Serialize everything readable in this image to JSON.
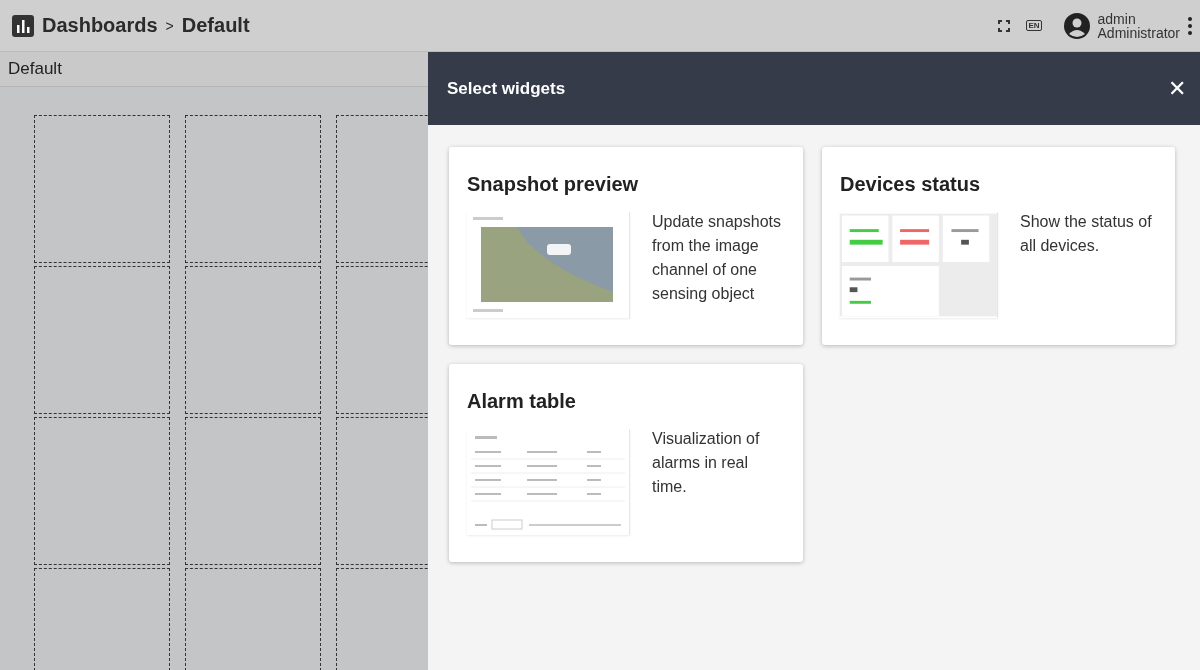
{
  "header": {
    "breadcrumb": [
      {
        "label": "Dashboards"
      },
      {
        "label": "Default"
      }
    ],
    "separator": ">",
    "language": "EN",
    "user": {
      "name": "admin",
      "role": "Administrator"
    }
  },
  "dashboard": {
    "title": "Default"
  },
  "panel": {
    "title": "Select widgets",
    "close": "✕",
    "widgets": [
      {
        "kind": "snapshot",
        "title": "Snapshot preview",
        "description": "Update snapshots from the image channel of one sensing object"
      },
      {
        "kind": "status",
        "title": "Devices status",
        "description": "Show the status of all devices."
      },
      {
        "kind": "table",
        "title": "Alarm table",
        "description": "Visualization of alarms in real time."
      }
    ]
  }
}
